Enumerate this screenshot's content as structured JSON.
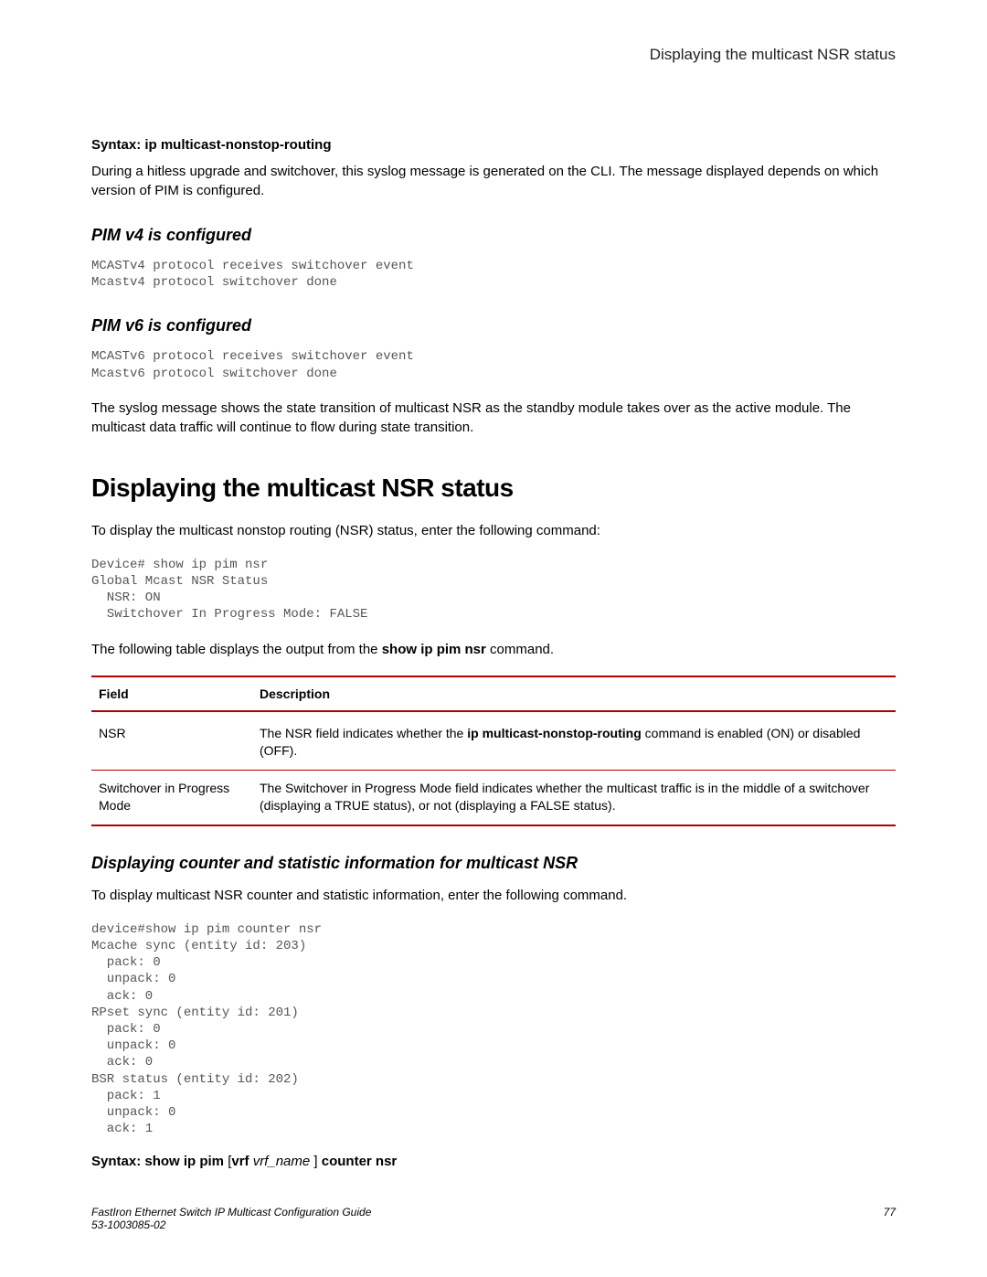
{
  "header": {
    "running_title": "Displaying the multicast NSR status"
  },
  "section1": {
    "syntax": "Syntax: ip multicast-nonstop-routing",
    "paragraph": "During a hitless upgrade and switchover, this syslog message is generated on the CLI. The message displayed depends on which version of PIM is configured."
  },
  "pim_v4": {
    "heading": "PIM v4 is configured",
    "code": "MCASTv4 protocol receives switchover event\nMcastv4 protocol switchover done"
  },
  "pim_v6": {
    "heading": "PIM v6 is configured",
    "code": "MCASTv6 protocol receives switchover event\nMcastv6 protocol switchover done",
    "paragraph": "The syslog message shows the state transition of multicast NSR as the standby module takes over as the active module. The multicast data traffic will continue to flow during state transition."
  },
  "main": {
    "heading": "Displaying the multicast NSR status",
    "intro": "To display the multicast nonstop routing (NSR) status, enter the following command:",
    "code": "Device# show ip pim nsr\nGlobal Mcast NSR Status\n  NSR: ON\n  Switchover In Progress Mode: FALSE",
    "table_intro_pre": "The following table displays the output from the ",
    "table_intro_cmd": "show ip pim nsr",
    "table_intro_post": " command."
  },
  "table": {
    "headers": {
      "field": "Field",
      "desc": "Description"
    },
    "rows": [
      {
        "field": "NSR",
        "desc_pre": "The NSR field indicates whether the ",
        "desc_bold": "ip multicast-nonstop-routing",
        "desc_post": " command is enabled (ON) or disabled (OFF)."
      },
      {
        "field": "Switchover in Progress Mode",
        "desc_pre": "The Switchover in Progress Mode field indicates whether the multicast traffic is in the middle of a switchover (displaying a TRUE status), or not (displaying a FALSE status).",
        "desc_bold": "",
        "desc_post": ""
      }
    ]
  },
  "counter": {
    "heading": "Displaying counter and statistic information for multicast NSR",
    "intro": "To display multicast NSR counter and statistic information, enter the following command.",
    "code": "device#show ip pim counter nsr\nMcache sync (entity id: 203)\n  pack: 0\n  unpack: 0\n  ack: 0\nRPset sync (entity id: 201)\n  pack: 0\n  unpack: 0\n  ack: 0\nBSR status (entity id: 202)\n  pack: 1\n  unpack: 0\n  ack: 1",
    "syntax_pre": "Syntax: show ip pim ",
    "syntax_bracket_open": "[",
    "syntax_vrf": "vrf ",
    "syntax_vrf_name": "vrf_name ",
    "syntax_bracket_close": "] ",
    "syntax_post": "counter nsr"
  },
  "footer": {
    "title": "FastIron Ethernet Switch IP Multicast Configuration Guide",
    "docnum": "53-1003085-02",
    "page": "77"
  }
}
